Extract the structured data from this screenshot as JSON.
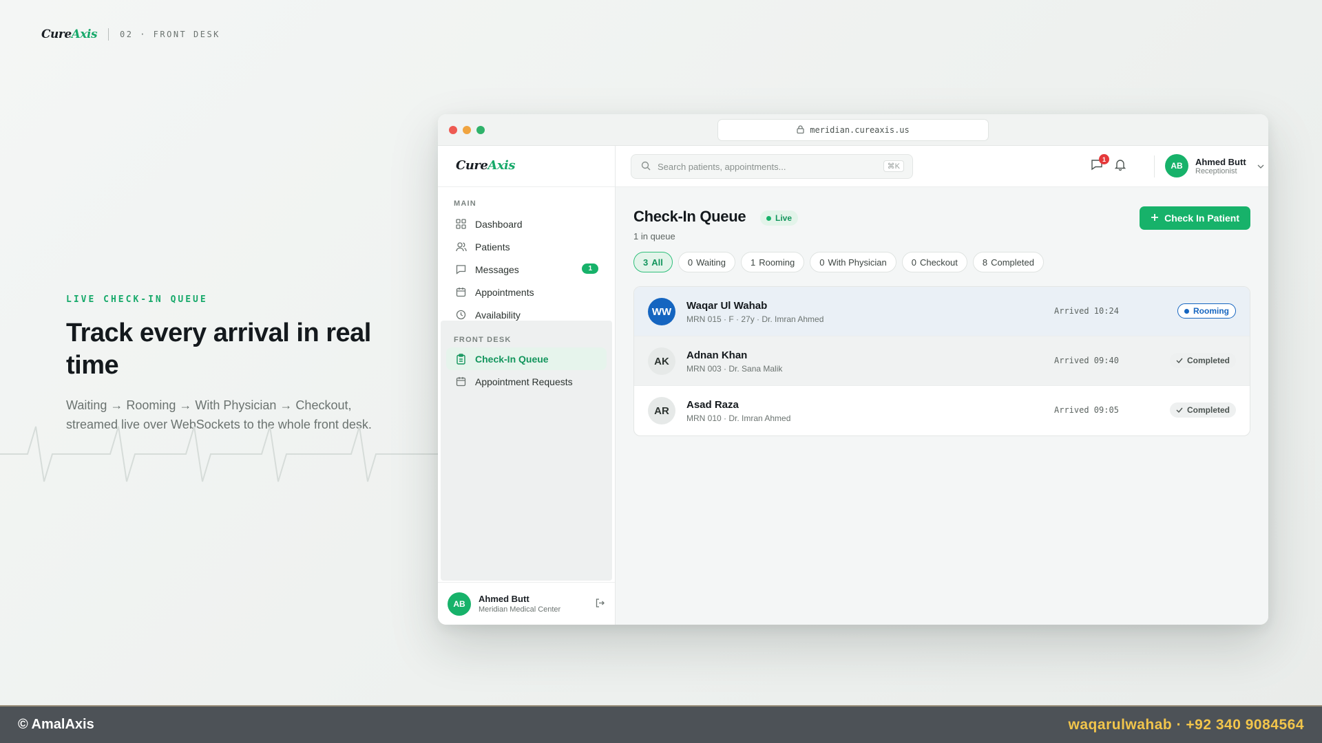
{
  "brand": {
    "name_part1": "Cure",
    "name_part2": "Axis"
  },
  "top": {
    "section_label": "02 · FRONT DESK"
  },
  "hero": {
    "eyebrow": "LIVE CHECK-IN QUEUE",
    "headline": "Track every arrival in real time",
    "subtext": "Waiting → Rooming → With Physician → Checkout, streamed live over WebSockets to the whole front desk."
  },
  "browser": {
    "url": "meridian.cureaxis.us"
  },
  "colors": {
    "accent": "#17b26a",
    "rooming": "#1565c0",
    "badge_red": "#e5393a",
    "footer_bg": "#4d5257",
    "footer_contact": "#f2c54b"
  },
  "sidebar": {
    "main_label": "MAIN",
    "main_items": [
      {
        "label": "Dashboard",
        "icon": "grid-icon"
      },
      {
        "label": "Patients",
        "icon": "users-icon"
      },
      {
        "label": "Messages",
        "icon": "message-icon",
        "badge": "1"
      },
      {
        "label": "Appointments",
        "icon": "calendar-icon"
      },
      {
        "label": "Availability",
        "icon": "clock-icon"
      }
    ],
    "frontdesk_label": "FRONT DESK",
    "frontdesk_items": [
      {
        "label": "Check-In Queue",
        "icon": "clipboard-icon",
        "active": true
      },
      {
        "label": "Appointment Requests",
        "icon": "calendar-icon"
      }
    ],
    "user": {
      "initials": "AB",
      "name": "Ahmed Butt",
      "org": "Meridian Medical Center"
    }
  },
  "header": {
    "search_placeholder": "Search patients, appointments...",
    "search_shortcut": "⌘K",
    "notification_count": "1",
    "user": {
      "initials": "AB",
      "name": "Ahmed Butt",
      "role": "Receptionist"
    }
  },
  "main": {
    "title": "Check-In Queue",
    "live_label": "Live",
    "queue_count": "1 in queue",
    "checkin_button": "Check In Patient",
    "filters": [
      {
        "count": "3",
        "label": "All",
        "active": true
      },
      {
        "count": "0",
        "label": "Waiting"
      },
      {
        "count": "1",
        "label": "Rooming"
      },
      {
        "count": "0",
        "label": "With Physician"
      },
      {
        "count": "0",
        "label": "Checkout"
      },
      {
        "count": "8",
        "label": "Completed"
      }
    ],
    "patients": [
      {
        "initials": "WW",
        "name": "Waqar Ul Wahab",
        "meta": "MRN 015 · F · 27y · Dr. Imran Ahmed",
        "arrived": "Arrived 10:24",
        "status": "Rooming"
      },
      {
        "initials": "AK",
        "name": "Adnan Khan",
        "meta": "MRN 003 · Dr. Sana Malik",
        "arrived": "Arrived 09:40",
        "status": "Completed"
      },
      {
        "initials": "AR",
        "name": "Asad Raza",
        "meta": "MRN 010 · Dr. Imran Ahmed",
        "arrived": "Arrived 09:05",
        "status": "Completed"
      }
    ]
  },
  "footer": {
    "copyright": "© AmalAxis",
    "contact": "waqarulwahab · +92 340 9084564"
  }
}
